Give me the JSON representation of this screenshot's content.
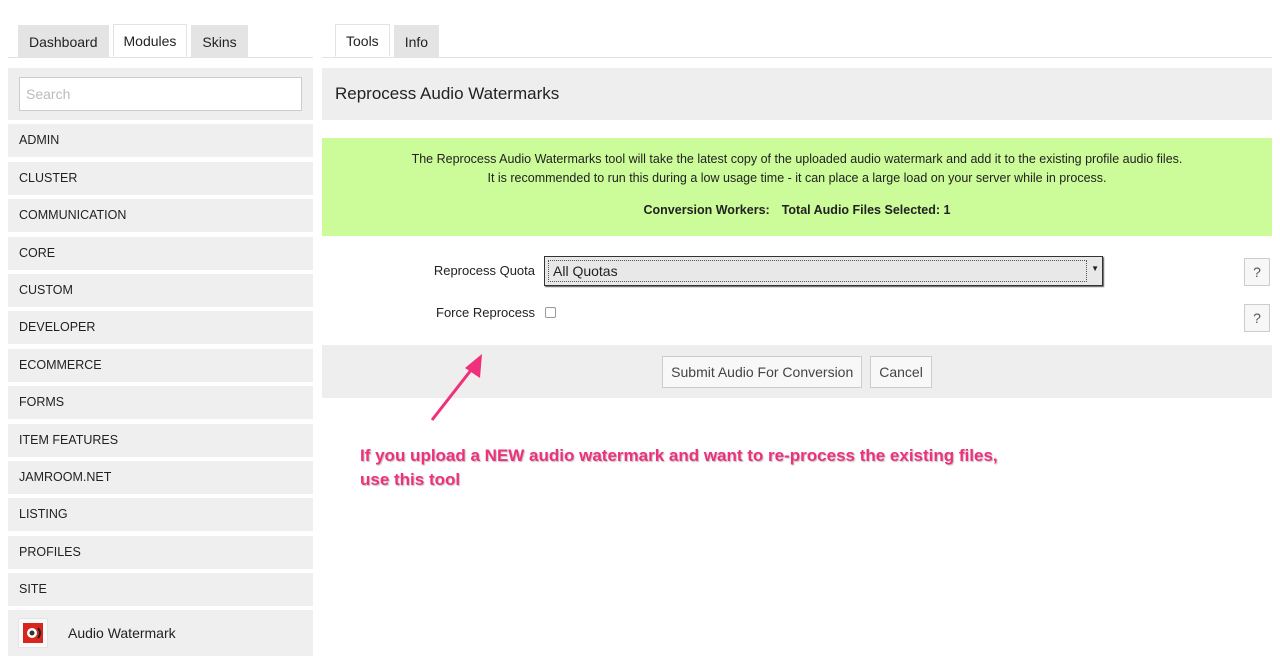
{
  "left_tabs": [
    {
      "label": "Dashboard"
    },
    {
      "label": "Modules"
    },
    {
      "label": "Skins"
    }
  ],
  "right_tabs": [
    {
      "label": "Tools"
    },
    {
      "label": "Info"
    }
  ],
  "search": {
    "placeholder": "Search"
  },
  "categories": [
    "ADMIN",
    "CLUSTER",
    "COMMUNICATION",
    "CORE",
    "CUSTOM",
    "DEVELOPER",
    "ECOMMERCE",
    "FORMS",
    "ITEM FEATURES",
    "JAMROOM.NET",
    "LISTING",
    "PROFILES",
    "SITE"
  ],
  "module": {
    "label": "Audio Watermark"
  },
  "page_title": "Reprocess Audio Watermarks",
  "notice": {
    "line1": "The Reprocess Audio Watermarks tool will take the latest copy of the uploaded audio watermark and add it to the existing profile audio files.",
    "line2": "It is recommended to run this during a low usage time - it can place a large load on your server while in process.",
    "workers": "Conversion Workers:",
    "total": "Total Audio Files Selected: 1"
  },
  "form": {
    "quota_label": "Reprocess Quota",
    "quota_value": "All Quotas",
    "force_label": "Force Reprocess",
    "help": "?"
  },
  "buttons": {
    "submit": "Submit Audio For Conversion",
    "cancel": "Cancel"
  },
  "annotation": "If you upload a NEW audio watermark and want to re-process the existing files, use this tool",
  "colors": {
    "notice_bg": "#ccfb99",
    "annotation": "#f0307a"
  }
}
